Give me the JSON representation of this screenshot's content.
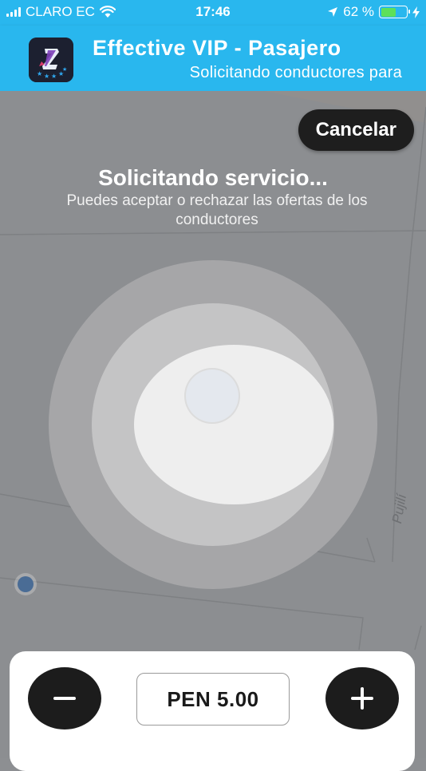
{
  "status_bar": {
    "carrier": "CLARO EC",
    "time": "17:46",
    "battery_percent": "62 %",
    "battery_level": 0.62
  },
  "app_header": {
    "title": "Effective VIP - Pasajero",
    "subtitle": "Solicitando conductores para"
  },
  "map": {
    "street_label": "Pujilí"
  },
  "request": {
    "cancel_label": "Cancelar",
    "title": "Solicitando servicio...",
    "subtitle": "Puedes aceptar o rechazar las ofertas de los conductores"
  },
  "fare": {
    "value": "PEN 5.00",
    "decrease_icon": "minus-icon",
    "increase_icon": "plus-icon"
  },
  "colors": {
    "header": "#29b7ee",
    "button_dark": "#1e1e1e",
    "battery": "#5de05a"
  }
}
